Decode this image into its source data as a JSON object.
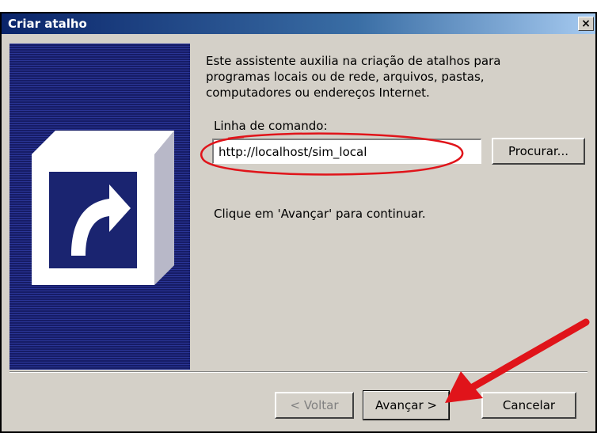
{
  "dialog": {
    "title": "Criar atalho",
    "close_symbol": "×",
    "description": "Este assistente auxilia na criação de atalhos para programas locais ou de rede, arquivos, pastas, computadores ou endereços Internet.",
    "command_label": "Linha de comando:",
    "command_value": "http://localhost/sim_local",
    "browse_label": "Procurar...",
    "hint": "Clique em 'Avançar' para continuar.",
    "back_label": "< Voltar",
    "next_label": "Avançar >",
    "cancel_label": "Cancelar"
  },
  "icons": {
    "side": "shortcut-arrow-icon",
    "close": "close-icon"
  },
  "annotations": {
    "highlight": "red-ellipse",
    "pointer": "red-arrow"
  },
  "colors": {
    "titlebar": "#0a246a",
    "dialog_bg": "#d4d0c8",
    "side_panel": "#202878",
    "annotation": "#e0141a"
  }
}
